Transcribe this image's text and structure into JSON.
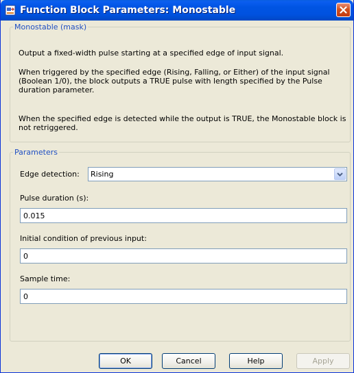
{
  "window": {
    "title": "Function Block Parameters: Monostable"
  },
  "mask_group": {
    "legend": "Monostable (mask)",
    "paragraphs": [
      "Output a fixed-width pulse starting at a specified edge of input signal.",
      "When triggered by the specified edge (Rising, Falling, or Either) of the input signal (Boolean 1/0), the block outputs a TRUE pulse with length specified by the Pulse duration parameter.",
      "When the specified edge is detected while the output is TRUE, the Monostable block is not retriggered."
    ]
  },
  "params_group": {
    "legend": "Parameters",
    "edge_detection": {
      "label": "Edge detection:",
      "value": "Rising"
    },
    "pulse_duration": {
      "label": "Pulse duration (s):",
      "value": "0.015"
    },
    "initial_condition": {
      "label": "Initial condition of previous input:",
      "value": "0"
    },
    "sample_time": {
      "label": "Sample time:",
      "value": "0"
    }
  },
  "buttons": {
    "ok": "OK",
    "cancel": "Cancel",
    "help": "Help",
    "apply": "Apply"
  },
  "colors": {
    "titlebar": "#0054e3",
    "group_legend": "#1f4fc2",
    "dialog_bg": "#ece9d8"
  }
}
